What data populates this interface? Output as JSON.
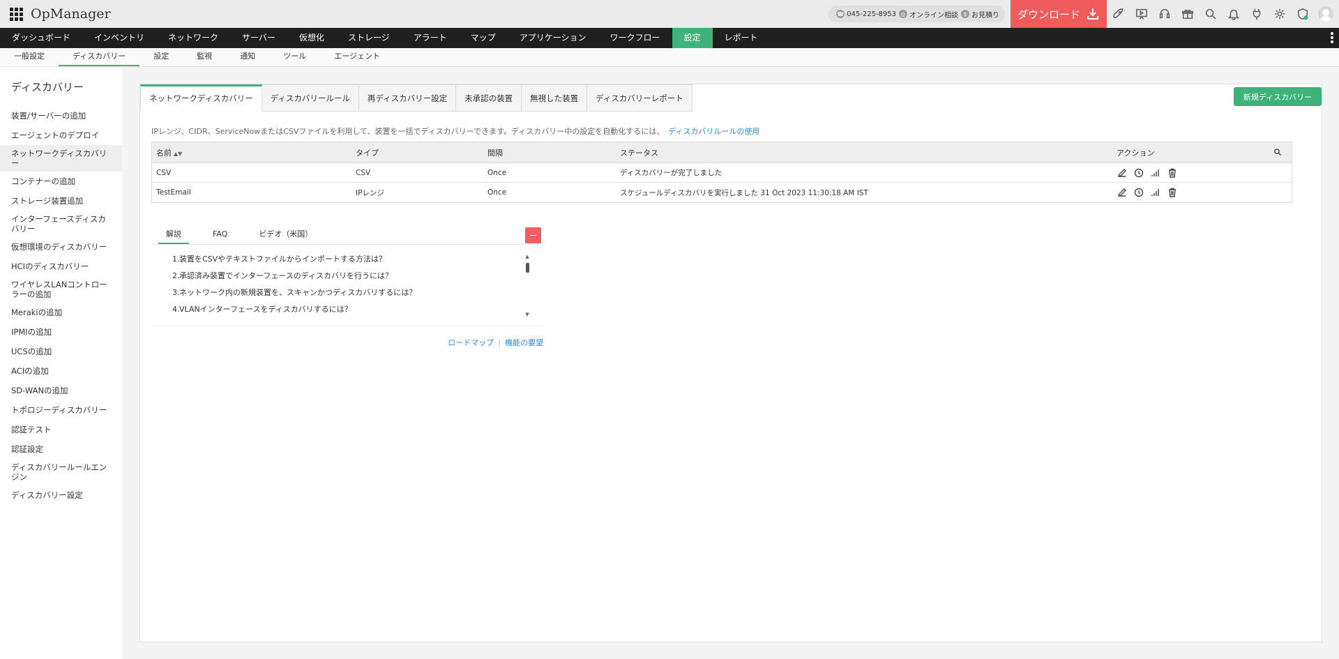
{
  "app": {
    "title": "OpManager"
  },
  "topbar": {
    "phone": "045-225-8953",
    "online_consult": "オンライン相談",
    "estimate": "お見積り",
    "download_label": "ダウンロード",
    "icons": [
      "rocket-icon",
      "presentation-icon",
      "headset-icon",
      "gift-icon",
      "search-icon",
      "bell-icon",
      "plug-icon",
      "gear-icon",
      "shield-icon",
      "user-avatar"
    ]
  },
  "main_nav": {
    "items": [
      "ダッシュボード",
      "インベントリ",
      "ネットワーク",
      "サーバー",
      "仮想化",
      "ストレージ",
      "アラート",
      "マップ",
      "アプリケーション",
      "ワークフロー",
      "設定",
      "レポート"
    ],
    "active": "設定"
  },
  "sub_nav": {
    "items": [
      "一般設定",
      "ディスカバリー",
      "設定",
      "監視",
      "通知",
      "ツール",
      "エージェント"
    ],
    "active": "ディスカバリー"
  },
  "sidebar": {
    "title": "ディスカバリー",
    "items": [
      "装置/サーバーの追加",
      "エージェントのデプロイ",
      "ネットワークディスカバリー",
      "コンテナーの追加",
      "ストレージ装置追加",
      "インターフェースディスカバリー",
      "仮想環境のディスカバリー",
      "HCIのディスカバリー",
      "ワイヤレスLANコントローラーの追加",
      "Merakiの追加",
      "IPMIの追加",
      "UCSの追加",
      "ACIの追加",
      "SD-WANの追加",
      "トポロジーディスカバリー",
      "認証テスト",
      "認証設定",
      "ディスカバリールールエンジン",
      "ディスカバリー設定"
    ],
    "active": "ネットワークディスカバリー"
  },
  "tabs": {
    "items": [
      "ネットワークディスカバリー",
      "ディスカバリールール",
      "再ディスカバリー設定",
      "未承認の装置",
      "無視した装置",
      "ディスカバリーレポート"
    ],
    "active": "ネットワークディスカバリー"
  },
  "new_discovery_label": "新規ディスカバリー",
  "description": {
    "text": "IPレンジ、CIDR、ServiceNowまたはCSVファイルを利用して、装置を一括でディスカバリーできます。ディスカバリー中の設定を自動化するには、",
    "link": "ディスカバリルールの使用"
  },
  "table": {
    "headers": [
      "名前",
      "タイプ",
      "間隔",
      "ステータス",
      "アクション"
    ],
    "rows": [
      {
        "name": "CSV",
        "type": "CSV",
        "interval": "Once",
        "status": "ディスカバリーが完了しました"
      },
      {
        "name": "TestEmail",
        "type": "IPレンジ",
        "interval": "Once",
        "status": "スケジュールディスカバリを実行しました 31 Oct 2023 11:30:18 AM IST"
      }
    ],
    "action_icons": [
      "edit-icon",
      "clock-icon",
      "signal-icon",
      "trash-icon"
    ]
  },
  "help": {
    "tabs": [
      "解説",
      "FAQ",
      "ビデオ（米国）"
    ],
    "active": "解説",
    "items": [
      {
        "num": "1.",
        "text": "装置をCSVやテキストファイルからインポートする方法は？"
      },
      {
        "num": "2.",
        "text": "承認済み装置でインターフェースのディスカバリを行うには？"
      },
      {
        "num": "3.",
        "text": "ネットワーク内の新規装置を、スキャンかつディスカバリするには？"
      },
      {
        "num": "4.",
        "text": "VLANインターフェースをディスカバリするには？"
      }
    ],
    "roadmap": "ロードマップ",
    "separator": "|",
    "feature_request": "機能の要望"
  },
  "colors": {
    "accent": "#3db37a",
    "danger": "#f25b5b",
    "nav_bg": "#1f1f1f",
    "link": "#2d8bd0"
  }
}
